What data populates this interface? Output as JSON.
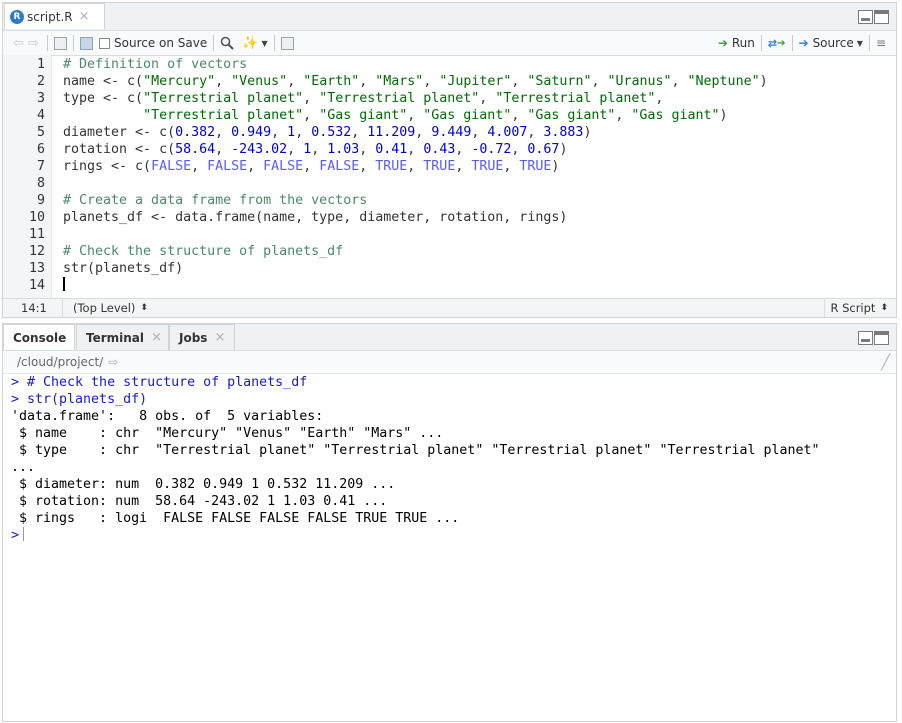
{
  "editor": {
    "tab": {
      "icon": "r-file-icon",
      "label": "script.R"
    },
    "toolbar": {
      "source_on_save": "Source on Save",
      "run": "Run",
      "source": "Source"
    },
    "lines": [
      {
        "n": "1",
        "html": "<span class=\"c-com\"># Definition of vectors</span>"
      },
      {
        "n": "2",
        "html": "name &lt;- c(<span class=\"c-str\">\"Mercury\"</span>, <span class=\"c-str\">\"Venus\"</span>, <span class=\"c-str\">\"Earth\"</span>, <span class=\"c-str\">\"Mars\"</span>, <span class=\"c-str\">\"Jupiter\"</span>, <span class=\"c-str\">\"Saturn\"</span>, <span class=\"c-str\">\"Uranus\"</span>, <span class=\"c-str\">\"Neptune\"</span>)"
      },
      {
        "n": "3",
        "html": "type &lt;- c(<span class=\"c-str\">\"Terrestrial planet\"</span>, <span class=\"c-str\">\"Terrestrial planet\"</span>, <span class=\"c-str\">\"Terrestrial planet\"</span>,"
      },
      {
        "n": "4",
        "html": "          <span class=\"c-str\">\"Terrestrial planet\"</span>, <span class=\"c-str\">\"Gas giant\"</span>, <span class=\"c-str\">\"Gas giant\"</span>, <span class=\"c-str\">\"Gas giant\"</span>, <span class=\"c-str\">\"Gas giant\"</span>)"
      },
      {
        "n": "5",
        "html": "diameter &lt;- c(<span class=\"c-num\">0.382</span>, <span class=\"c-num\">0.949</span>, <span class=\"c-num\">1</span>, <span class=\"c-num\">0.532</span>, <span class=\"c-num\">11.209</span>, <span class=\"c-num\">9.449</span>, <span class=\"c-num\">4.007</span>, <span class=\"c-num\">3.883</span>)"
      },
      {
        "n": "6",
        "html": "rotation &lt;- c(<span class=\"c-num\">58.64</span>, <span class=\"c-num\">-243.02</span>, <span class=\"c-num\">1</span>, <span class=\"c-num\">1.03</span>, <span class=\"c-num\">0.41</span>, <span class=\"c-num\">0.43</span>, <span class=\"c-num\">-0.72</span>, <span class=\"c-num\">0.67</span>)"
      },
      {
        "n": "7",
        "html": "rings &lt;- c(<span class=\"c-kw\">FALSE</span>, <span class=\"c-kw\">FALSE</span>, <span class=\"c-kw\">FALSE</span>, <span class=\"c-kw\">FALSE</span>, <span class=\"c-kw\">TRUE</span>, <span class=\"c-kw\">TRUE</span>, <span class=\"c-kw\">TRUE</span>, <span class=\"c-kw\">TRUE</span>)"
      },
      {
        "n": "8",
        "html": ""
      },
      {
        "n": "9",
        "html": "<span class=\"c-com\"># Create a data frame from the vectors</span>"
      },
      {
        "n": "10",
        "html": "planets_df &lt;- data.frame(name, type, diameter, rotation, rings)"
      },
      {
        "n": "11",
        "html": ""
      },
      {
        "n": "12",
        "html": "<span class=\"c-com\"># Check the structure of planets_df</span>"
      },
      {
        "n": "13",
        "html": "str(planets_df)"
      },
      {
        "n": "14",
        "html": "<span class=\"cursor\"></span>"
      }
    ],
    "status": {
      "position": "14:1",
      "scope": "(Top Level)",
      "file_type": "R Script"
    }
  },
  "console": {
    "tabs": [
      {
        "label": "Console",
        "closable": false
      },
      {
        "label": "Terminal",
        "closable": true
      },
      {
        "label": "Jobs",
        "closable": true
      }
    ],
    "path": "/cloud/project/",
    "output": [
      {
        "cls": "c-in",
        "text": "> # Check the structure of planets_df"
      },
      {
        "cls": "c-in",
        "text": "> str(planets_df)"
      },
      {
        "cls": "",
        "text": "'data.frame':\t8 obs. of  5 variables:"
      },
      {
        "cls": "",
        "text": " $ name    : chr  \"Mercury\" \"Venus\" \"Earth\" \"Mars\" ..."
      },
      {
        "cls": "",
        "text": " $ type    : chr  \"Terrestrial planet\" \"Terrestrial planet\" \"Terrestrial planet\" \"Terrestrial planet\""
      },
      {
        "cls": "",
        "text": "..."
      },
      {
        "cls": "",
        "text": " $ diameter: num  0.382 0.949 1 0.532 11.209 ..."
      },
      {
        "cls": "",
        "text": " $ rotation: num  58.64 -243.02 1 1.03 0.41 ..."
      },
      {
        "cls": "",
        "text": " $ rings   : logi  FALSE FALSE FALSE FALSE TRUE TRUE ..."
      }
    ],
    "prompt": ">"
  },
  "colors": {
    "comment": "#4c886b",
    "string": "#036a07",
    "number": "#0000cd",
    "keyword": "#585cf6",
    "console_input": "#1a1acd",
    "run_arrow": "#3a9a3a",
    "source_arrow": "#2f7bc8"
  }
}
